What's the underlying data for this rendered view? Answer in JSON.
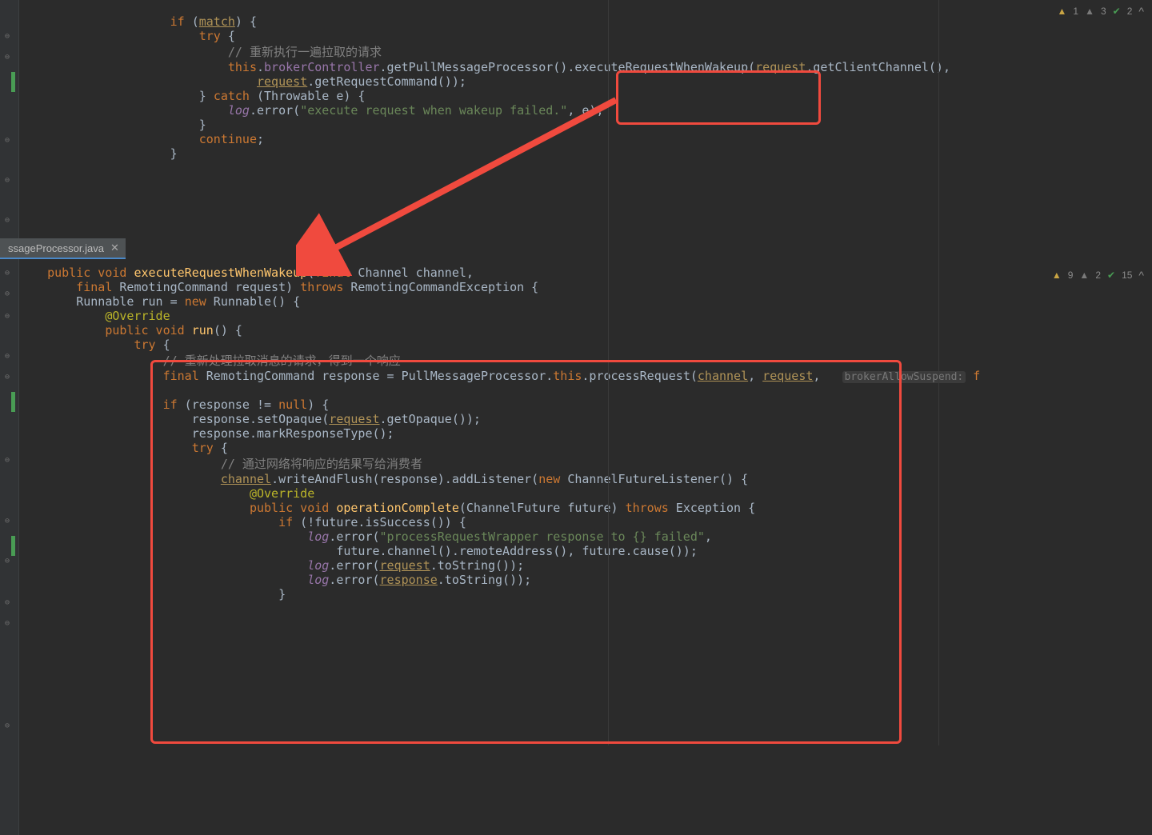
{
  "inspections_top": {
    "warn": "1",
    "weak": "3",
    "ok": "2"
  },
  "inspections_bottom": {
    "warn": "9",
    "weak": "2",
    "ok": "15"
  },
  "tab": {
    "name": "ssageProcessor.java"
  },
  "upper": {
    "l1_if": "if",
    "l1_match": "match",
    "l1_tail": ") {",
    "l2_try": "try",
    "l2_brace": " {",
    "l3_cmt": "// 重新执行一遍拉取的请求",
    "l4_this": "this",
    "l4_dot1": ".",
    "l4_bc": "brokerController",
    "l4_getpp": ".getPullMessageProcessor().",
    "l4_exec": "executeRequestWhenWakeup",
    "l4_open": "(",
    "l4_req": "request",
    "l4_gcc": ".getClientChannel(),",
    "l5_req": "request",
    "l5_grc": ".getRequestCommand());",
    "l6_close": "} ",
    "l6_catch": "catch",
    "l6_thr": " (Throwable e) {",
    "l7_log": "log",
    "l7_err": ".error(",
    "l7_msg": "\"execute request when wakeup failed.\"",
    "l7_tail": ", e);",
    "l8": "}",
    "l9_cont": "continue",
    "l9_semi": ";",
    "l10": "}"
  },
  "lower": {
    "l1_pub": "public void",
    "l1_name": "executeRequestWhenWakeup",
    "l1_op": "(",
    "l1_final": "final",
    "l1_chc": " Channel channel,",
    "l2_final": "final",
    "l2_rc": " RemotingCommand request) ",
    "l2_throws": "throws",
    "l2_exc": " RemotingCommandException {",
    "l3_runn": "Runnable run = ",
    "l3_new": "new",
    "l3_rcl": " Runnable() {",
    "l4_ann": "@Override",
    "l5_pub": "public void",
    "l5_run": " run",
    "l5_br": "() {",
    "l6_try": "try",
    "l6_br": " {",
    "l7_cmt": "// 重新处理拉取消息的请求，得到一个响应",
    "l8_final": "final",
    "l8_rc": " RemotingCommand response = PullMessageProcessor.",
    "l8_this": "this",
    "l8_pr": ".processRequest(",
    "l8_ch": "channel",
    "l8_c1": ", ",
    "l8_req": "request",
    "l8_c2": ",",
    "l8_hint_l": "brokerAllowSuspend:",
    "l8_hint_v": " f",
    "l10_if": "if",
    "l10_resp": " (response != ",
    "l10_null": "null",
    "l10_br": ") {",
    "l11_resp": "response.setOpaque(",
    "l11_req": "request",
    "l11_tail": ".getOpaque());",
    "l12": "response.markResponseType();",
    "l13_try": "try",
    "l13_br": " {",
    "l14_cmt": "// 通过网络将响应的结果写给消费者",
    "l15_ch": "channel",
    "l15_wf": ".writeAndFlush(response).addListener(",
    "l15_new": "new",
    "l15_cfl": " ChannelFutureListener() {",
    "l16_ann": "@Override",
    "l17_pub": "public void",
    "l17_oc": " operationComplete",
    "l17_args": "(ChannelFuture future) ",
    "l17_thr": "throws",
    "l17_exc": " Exception {",
    "l18_if": "if",
    "l18_cond": " (!future.isSuccess()) {",
    "l19_log": "log",
    "l19_err": ".error(",
    "l19_msg": "\"processRequestWrapper response to {} failed\"",
    "l19_c": ",",
    "l20": "future.channel().remoteAddress(), future.cause());",
    "l21_log": "log",
    "l21_err": ".error(",
    "l21_req": "request",
    "l21_ts": ".toString());",
    "l22_log": "log",
    "l22_err": ".error(",
    "l22_resp": "response",
    "l22_ts": ".toString());",
    "l23": "}"
  }
}
